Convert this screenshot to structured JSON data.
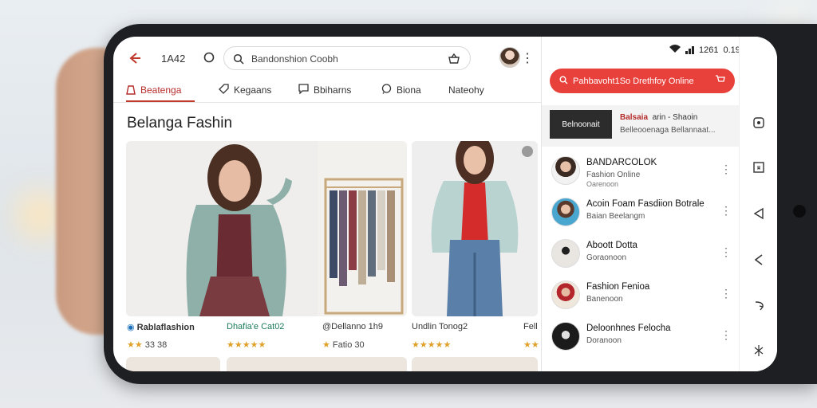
{
  "header": {
    "time": "1A42",
    "search_text": "Bandonshion Coobh"
  },
  "tabs": [
    {
      "label": "Beatenga",
      "icon": "bag-icon",
      "active": true
    },
    {
      "label": "Kegaans",
      "icon": "tag-icon",
      "active": false
    },
    {
      "label": "Bbiharns",
      "icon": "chat-icon",
      "active": false
    },
    {
      "label": "Biona",
      "icon": "store-icon",
      "active": false
    },
    {
      "label": "Nateohy",
      "icon": "",
      "active": false
    }
  ],
  "page_title": "Belanga Fashin",
  "products": [
    {
      "name": "Rablaflashion",
      "stars": "★★",
      "rating_text": "33 38"
    },
    {
      "name": "Dhafia'e Cat02",
      "stars": "★★★★★",
      "rating_text": ""
    },
    {
      "name": "@Dellanno 1h9",
      "stars": "★",
      "rating_text": "Fatio 30"
    },
    {
      "name": "Undlin Tonog2",
      "stars": "★★★★★",
      "rating_text": ""
    },
    {
      "name": "Fell",
      "stars": "★★",
      "rating_text": ""
    }
  ],
  "status_bar": {
    "time1": "1261",
    "time2": "0.19"
  },
  "banner": {
    "text": "Pahbavoht1So Drethfoy Online"
  },
  "promo": {
    "button_label": "Belnoonait",
    "line1_bold": "Balsaia",
    "line1_rest": "arin - Shaoin",
    "line2": "Belleooenaga Bellannaat..."
  },
  "chats": [
    {
      "name": "BANDARCOLOK",
      "sub": "Fashion Online",
      "sub2": "Oarenoon"
    },
    {
      "name": "Acoin Foam Fasdiion Botrale",
      "sub": "Baian Beelangm",
      "sub2": ""
    },
    {
      "name": "Aboott Dotta",
      "sub": "Goraonoon",
      "sub2": ""
    },
    {
      "name": "Fashion Fenioa",
      "sub": "Banenoon",
      "sub2": ""
    },
    {
      "name": "Deloonhnes Felocha",
      "sub": "Doranoon",
      "sub2": ""
    }
  ],
  "rail_icons": [
    "camera-icon",
    "bookmark-icon",
    "back-triangle-icon",
    "play-back-icon",
    "share-icon",
    "sparkle-icon"
  ],
  "colors": {
    "accent": "#e8413c",
    "tab_active": "#b52b2b",
    "star": "#e0a12a"
  }
}
